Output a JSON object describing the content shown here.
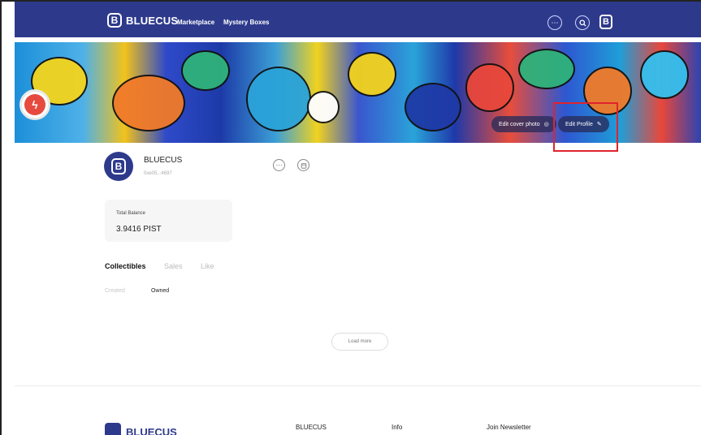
{
  "header": {
    "brand": "BLUECUS",
    "brand_glyph": "B",
    "nav": [
      "Marketplace",
      "Mystery Boxes"
    ],
    "icons": [
      "more-icon",
      "search-icon",
      "brand-logo-icon"
    ]
  },
  "cover": {
    "edit_cover_label": "Edit cover photo",
    "edit_profile_label": "Edit Profile"
  },
  "profile": {
    "username": "BLUECUS",
    "address": "0xe05...4697",
    "avatar_glyph": "B"
  },
  "balance": {
    "label": "Total Balance",
    "value": "3.9416 PIST"
  },
  "tabs": [
    "Collectibles",
    "Sales",
    "Like"
  ],
  "subtabs": [
    "Created",
    "Owned"
  ],
  "load_more": "Load more",
  "footer": {
    "brand": "BLUECUS",
    "columns": [
      "BLUECUS",
      "Info",
      "Join Newsletter"
    ]
  },
  "colors": {
    "header_bg": "#2d3a8c",
    "highlight": "#e0232e"
  }
}
